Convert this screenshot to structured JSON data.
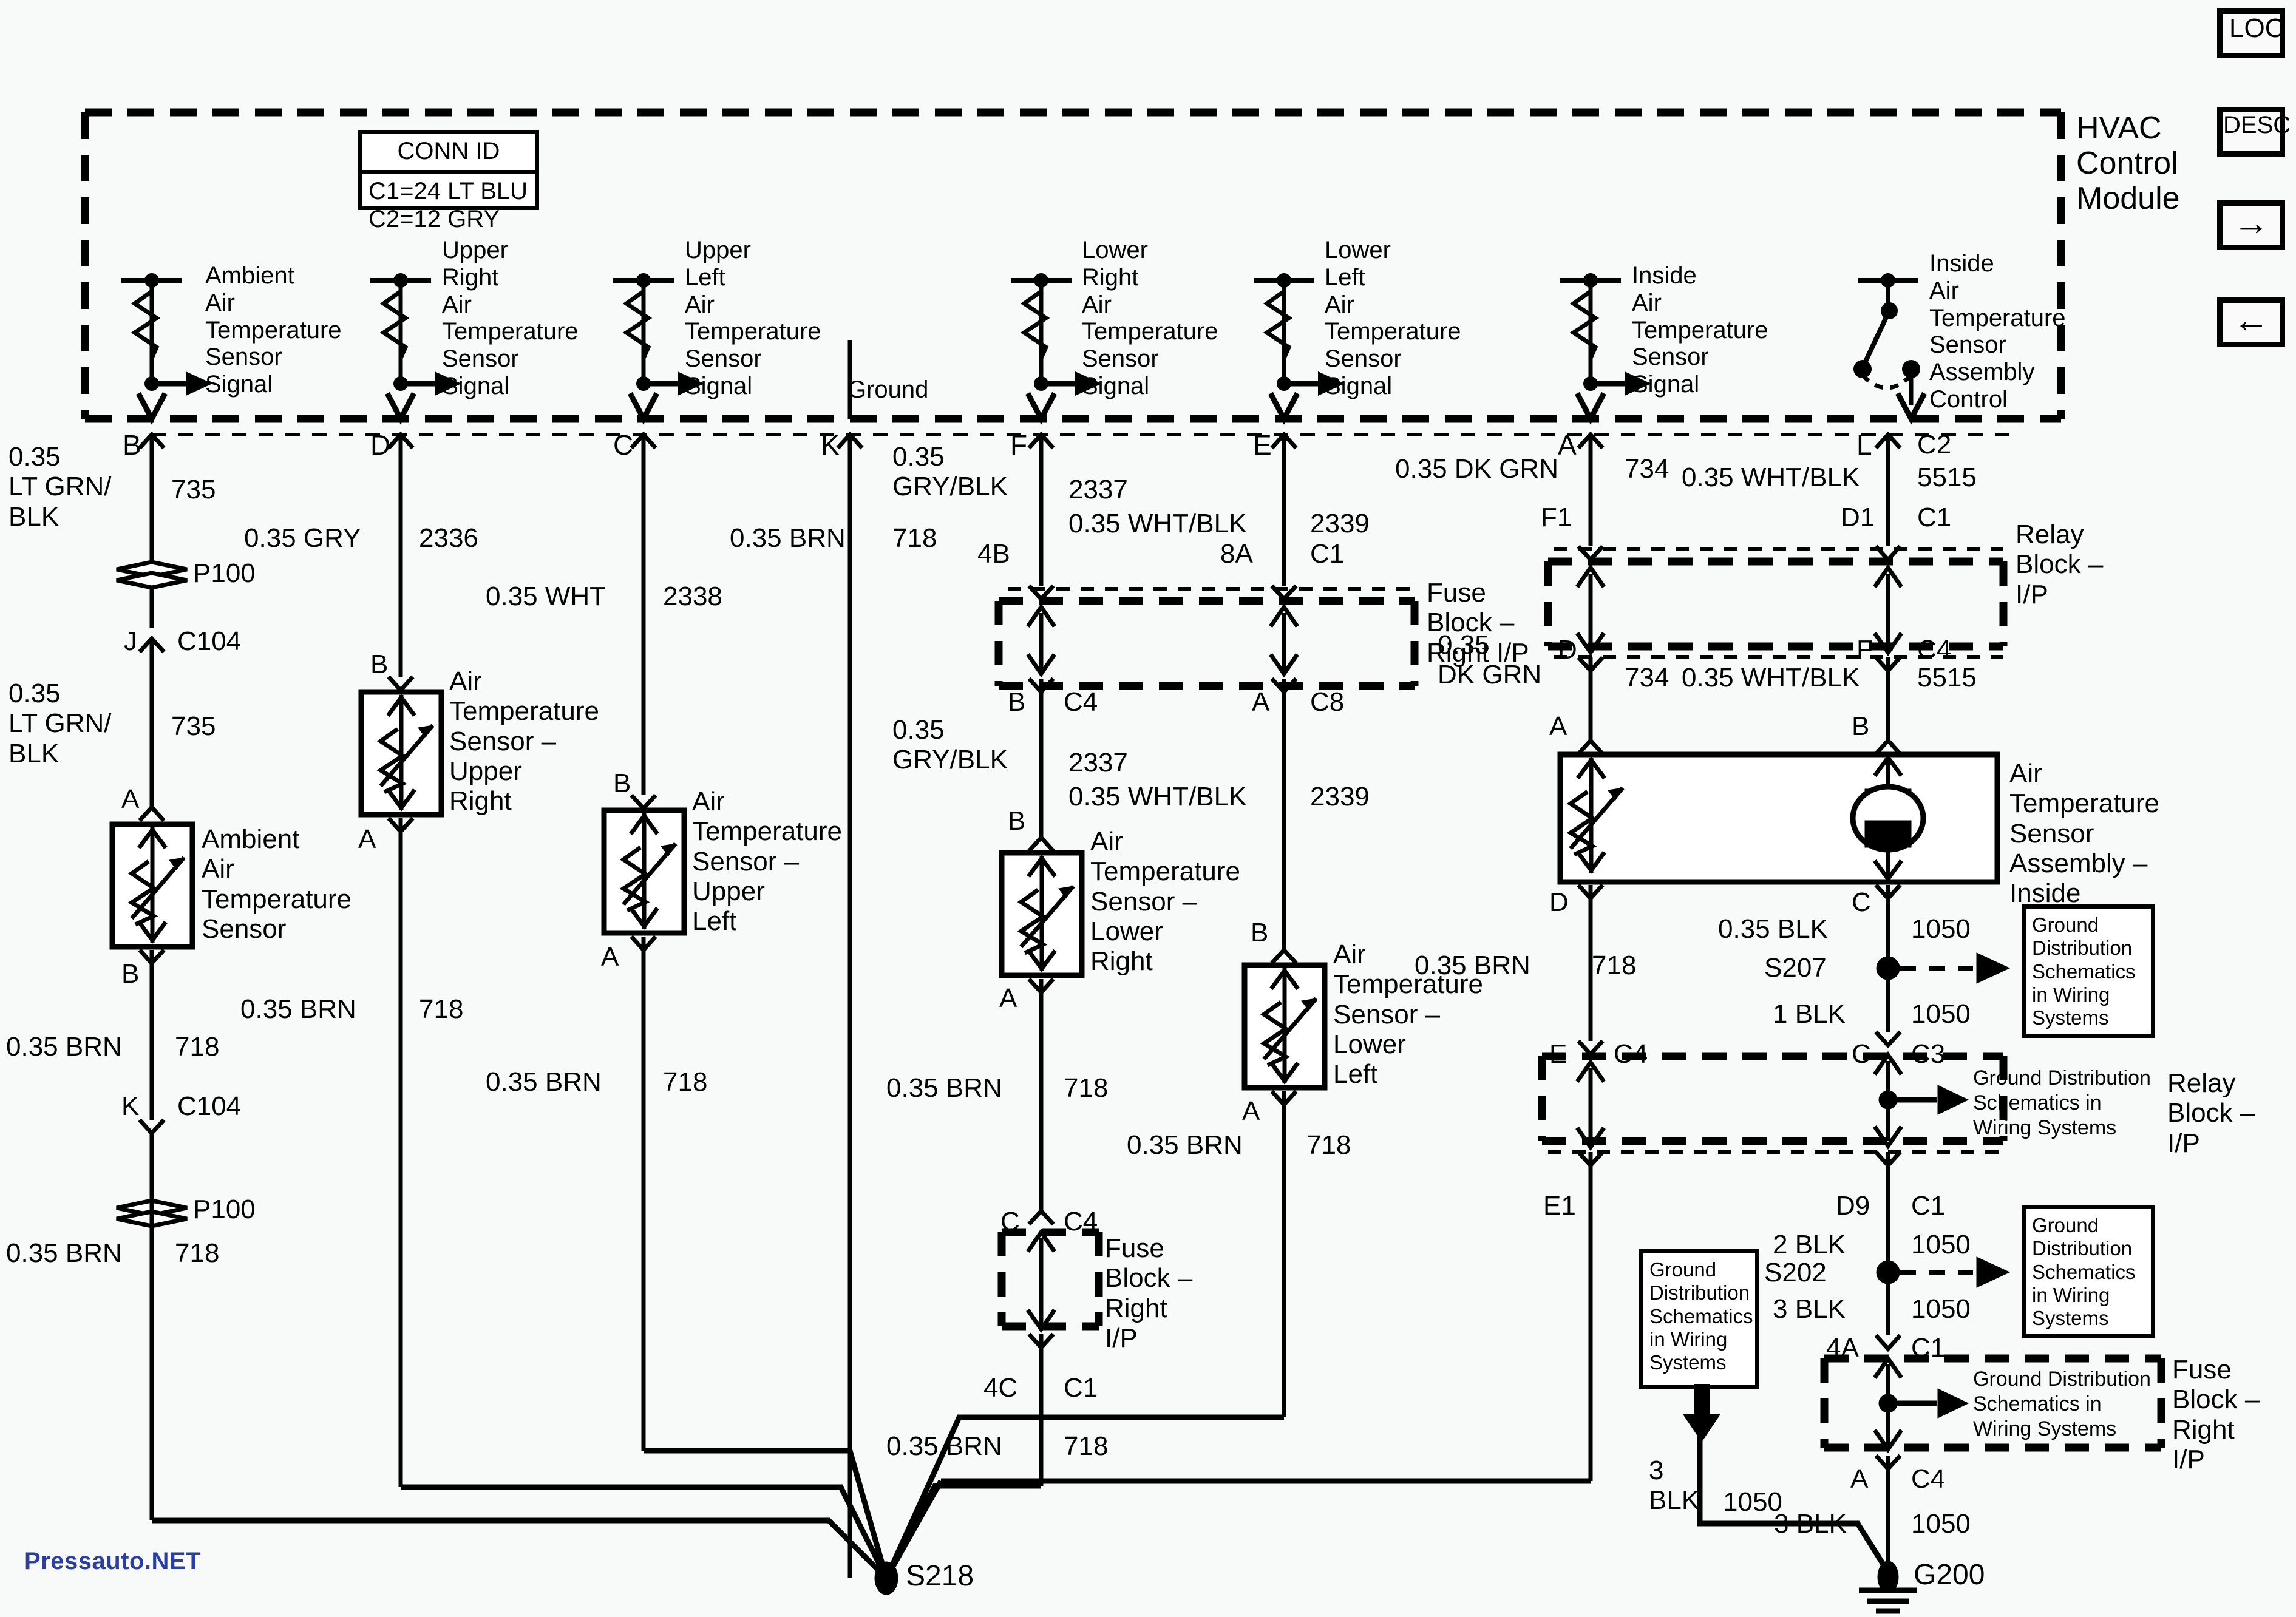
{
  "module": {
    "title": "HVAC\nControl\nModule",
    "conn_id": {
      "header": "CONN ID",
      "lines": "C1=24 LT BLU\nC2=12 GRY"
    }
  },
  "nav_buttons": [
    {
      "name": "loc-button",
      "label": "LOC"
    },
    {
      "name": "desc-button",
      "label": "DESC"
    },
    {
      "name": "next-button",
      "label": "→"
    },
    {
      "name": "prev-button",
      "label": "←"
    }
  ],
  "module_pins": [
    {
      "signal": "Ambient\nAir\nTemperature\nSensor\nSignal",
      "pin": "B"
    },
    {
      "signal": "Upper\nRight\nAir\nTemperature\nSensor\nSignal",
      "pin": "D"
    },
    {
      "signal": "Upper\nLeft\nAir\nTemperature\nSensor\nSignal",
      "pin": "C"
    },
    {
      "signal": "Ground",
      "pin": "K"
    },
    {
      "signal": "Lower\nRight\nAir\nTemperature\nSensor\nSignal",
      "pin": "F"
    },
    {
      "signal": "Lower\nLeft\nAir\nTemperature\nSensor\nSignal",
      "pin": "E"
    },
    {
      "signal": "Inside\nAir\nTemperature\nSensor\nSignal",
      "pin": "A"
    },
    {
      "signal": "Inside\nAir\nTemperature\nSensor\nAssembly\nControl",
      "pin": "L"
    }
  ],
  "devices": [
    {
      "name": "ambient-air-temperature-sensor",
      "label": "Ambient\nAir\nTemperature\nSensor"
    },
    {
      "name": "air-temperature-sensor-upper-right",
      "label": "Air\nTemperature\nSensor –\nUpper\nRight"
    },
    {
      "name": "air-temperature-sensor-upper-left",
      "label": "Air\nTemperature\nSensor –\nUpper\nLeft"
    },
    {
      "name": "air-temperature-sensor-lower-right",
      "label": "Air\nTemperature\nSensor –\nLower\nRight"
    },
    {
      "name": "air-temperature-sensor-lower-left",
      "label": "Air\nTemperature\nSensor –\nLower\nLeft"
    },
    {
      "name": "air-temperature-sensor-assembly-inside",
      "label": "Air\nTemperature\nSensor\nAssembly –\nInside"
    }
  ],
  "blocks": [
    {
      "name": "fuse-block-right-ip-top",
      "label": "Fuse\nBlock –\nRight I/P"
    },
    {
      "name": "relay-block-ip-top",
      "label": "Relay\nBlock –\nI/P"
    },
    {
      "name": "relay-block-ip-mid",
      "label": "Relay\nBlock –\nI/P"
    },
    {
      "name": "fuse-block-right-ip-mid",
      "label": "Fuse\nBlock –\nRight\nI/P"
    },
    {
      "name": "fuse-block-right-ip-bottom",
      "label": "Fuse\nBlock –\nRight\nI/P"
    }
  ],
  "ground_refs": [
    {
      "name": "ground-dist-ref-s207",
      "label": "Ground\nDistribution\nSchematics\nin Wiring\nSystems"
    },
    {
      "name": "ground-dist-ref-relay",
      "label": "Ground Distribution\nSchematics in\nWiring Systems"
    },
    {
      "name": "ground-dist-ref-s202",
      "label": "Ground\nDistribution\nSchematics\nin Wiring\nSystems"
    },
    {
      "name": "ground-dist-ref-fuse",
      "label": "Ground Distribution\nSchematics in\nWiring Systems"
    },
    {
      "name": "ground-dist-ref-e1",
      "label": "Ground\nDistribution\nSchematics\nin Wiring\nSystems"
    }
  ],
  "wires": {
    "w1": "0.35\nLT GRN/\nBLK",
    "w1n": "735",
    "w2": "0.35\nLT GRN/\nBLK",
    "w2n": "735",
    "w3": "0.35 GRY",
    "w3n": "2336",
    "w4": "0.35 WHT",
    "w4n": "2338",
    "w5": "0.35 BRN",
    "w5n": "718",
    "w6": "0.35\nGRY/BLK",
    "w6n": "2337",
    "w7": "0.35 WHT/BLK",
    "w7n": "2339",
    "w8": "0.35\nGRY/BLK",
    "w8n": "2337",
    "w9": "0.35 WHT/BLK",
    "w9n": "2339",
    "w10": "0.35 DK GRN",
    "w10n": "734",
    "w11": "0.35 WHT/BLK",
    "w11n": "5515",
    "w12": "0.35\nDK GRN",
    "w12n": "734",
    "w13": "0.35 WHT/BLK",
    "w13n": "5515",
    "w14": "0.35 BRN",
    "w14n": "718",
    "w15": "0.35 BLK",
    "w15n": "1050",
    "w16": "1 BLK",
    "w16n": "1050",
    "w17": "2 BLK",
    "w17n": "1050",
    "w18": "3 BLK",
    "w18n": "1050",
    "w19": "3\nBLK",
    "w19n": "1050",
    "w20": "3 BLK",
    "w20n": "1050",
    "brn_ur": "0.35 BRN",
    "brn_urn": "718",
    "brn_ul": "0.35 BRN",
    "brn_uln": "718",
    "brn_lr": "0.35 BRN",
    "brn_lrn": "718",
    "brn_ll": "0.35 BRN",
    "brn_lln": "718",
    "brn_c1": "0.35 BRN",
    "brn_c1n": "718",
    "brn_k": "0.35 BRN",
    "brn_kn": "718",
    "brn_p100": "0.35 BRN",
    "brn_p100n": "718"
  },
  "connector_tags": [
    "C104",
    "C104",
    "P100",
    "P100",
    "C4",
    "C1",
    "C4",
    "C8",
    "C1",
    "C2",
    "C1",
    "C4",
    "C3",
    "C1",
    "C1",
    "C4",
    "4B",
    "8A",
    "4C",
    "F1",
    "D1",
    "D9",
    "4A"
  ],
  "splices": [
    {
      "name": "splice-s218",
      "label": "S218"
    },
    {
      "name": "splice-s207",
      "label": "S207"
    },
    {
      "name": "splice-s202",
      "label": "S202"
    },
    {
      "name": "ground-g200",
      "label": "G200"
    }
  ],
  "inline_connectors": [
    {
      "name": "inline-p100-top",
      "label": "P100"
    },
    {
      "name": "inline-p100-bottom",
      "label": "P100"
    }
  ],
  "watermark": "Pressauto.NET"
}
